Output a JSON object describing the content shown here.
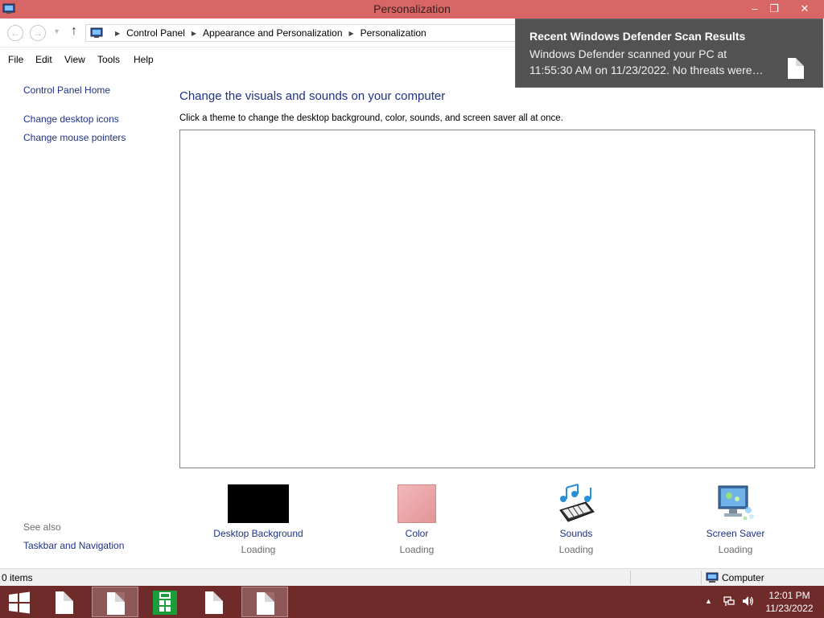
{
  "window": {
    "title": "Personalization",
    "controls": {
      "minimize": "–",
      "maximize": "❐",
      "close": "✕"
    }
  },
  "navigation": {
    "back_icon": "back-arrow-icon",
    "forward_icon": "forward-arrow-icon",
    "up_icon": "up-arrow-icon",
    "breadcrumb": [
      "Control Panel",
      "Appearance and Personalization",
      "Personalization"
    ]
  },
  "menu": [
    "File",
    "Edit",
    "View",
    "Tools",
    "Help"
  ],
  "sidebar": {
    "home_link": "Control Panel Home",
    "links": [
      "Change desktop icons",
      "Change mouse pointers"
    ],
    "see_also_label": "See also",
    "see_also_links": [
      "Taskbar and Navigation"
    ]
  },
  "main": {
    "heading": "Change the visuals and sounds on your computer",
    "instruction": "Click a theme to change the desktop background, color, sounds, and screen saver all at once.",
    "items": [
      {
        "label": "Desktop Background",
        "status": "Loading",
        "thumb_color": "#000000"
      },
      {
        "label": "Color",
        "status": "Loading",
        "thumb_color": "#e6a3a5"
      },
      {
        "label": "Sounds",
        "status": "Loading",
        "icon": "music-notes-keyboard-icon"
      },
      {
        "label": "Screen Saver",
        "status": "Loading",
        "icon": "monitor-bubbles-icon"
      }
    ]
  },
  "statusbar": {
    "items_count": "0 items",
    "location": "Computer"
  },
  "notification": {
    "title": "Recent Windows Defender Scan Results",
    "body": "Windows Defender scanned your PC at 11:55:30 AM on 11/23/2022. No threats were…"
  },
  "taskbar": {
    "clock_time": "12:01 PM",
    "clock_date": "11/23/2022"
  },
  "colors": {
    "titlebar": "#d96666",
    "taskbar": "#6f2a2a",
    "link": "#1e3287",
    "toast": "#525252"
  }
}
